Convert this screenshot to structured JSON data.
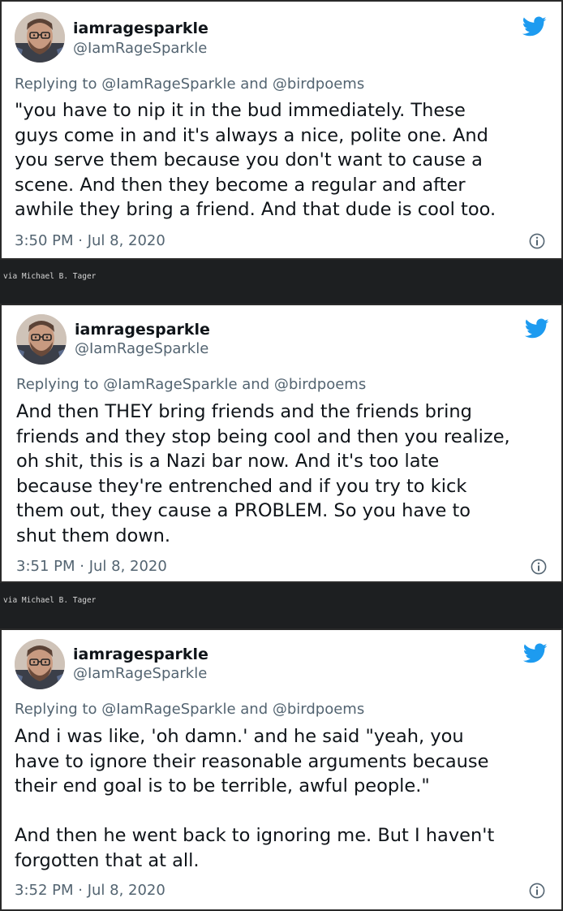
{
  "tweets": [
    {
      "display_name": "iamragesparkle",
      "handle": "@IamRageSparkle",
      "reply_prefix": "Replying to",
      "reply_to_1": "@IamRageSparkle",
      "reply_and": "and",
      "reply_to_2": "@birdpoems",
      "text": "\"you have to nip it in the bud immediately. These\nguys come in and it's always a nice, polite one. And\nyou serve them because you don't want to cause a\nscene. And then they become a regular and after\nawhile they bring a friend. And that dude is cool too.",
      "timestamp": "3:50 PM · Jul 8, 2020"
    },
    {
      "display_name": "iamragesparkle",
      "handle": "@IamRageSparkle",
      "reply_prefix": "Replying to",
      "reply_to_1": "@IamRageSparkle",
      "reply_and": "and",
      "reply_to_2": "@birdpoems",
      "text": "And then THEY bring friends and the friends bring\nfriends and they stop being cool and then you realize,\noh shit, this is a Nazi bar now. And it's too late\nbecause they're entrenched and if you try to kick\nthem out, they cause a PROBLEM. So you have to\nshut them down.",
      "timestamp": "3:51 PM · Jul 8, 2020"
    },
    {
      "display_name": "iamragesparkle",
      "handle": "@IamRageSparkle",
      "reply_prefix": "Replying to",
      "reply_to_1": "@IamRageSparkle",
      "reply_and": "and",
      "reply_to_2": "@birdpoems",
      "text": "And i was like, 'oh damn.' and he said \"yeah, you\nhave to ignore their reasonable arguments because\ntheir end goal is to be terrible, awful people.\"\n\nAnd then he went back to ignoring me. But I haven't\nforgotten that at all.",
      "timestamp": "3:52 PM · Jul 8, 2020"
    }
  ],
  "via_1": "via Michael B. Tager",
  "via_2": "via Michael B. Tager",
  "colors": {
    "twitter_blue": "#1d9bf0",
    "secondary_text": "#536471",
    "primary_text": "#0f1419",
    "strip_background": "#1d1f21"
  },
  "icons": {
    "brand": "twitter-bird-icon",
    "info": "info-icon",
    "avatar": "avatar"
  }
}
